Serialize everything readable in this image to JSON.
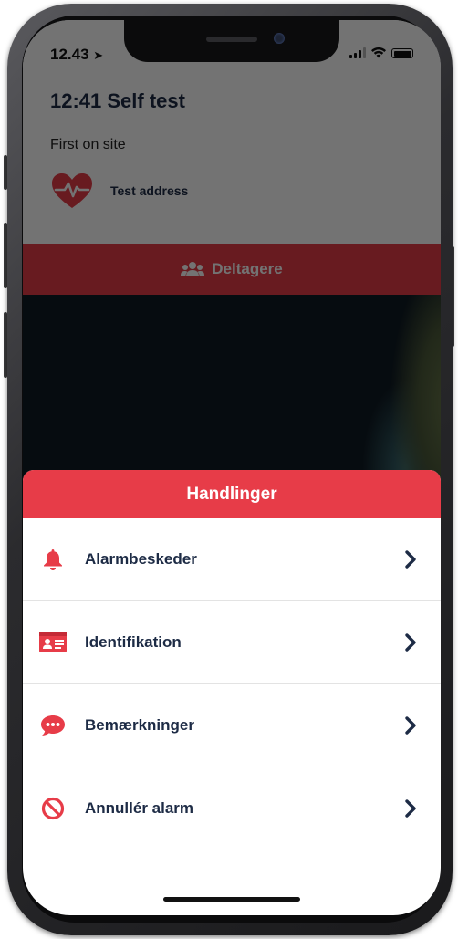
{
  "status_bar": {
    "time": "12.43"
  },
  "header": {
    "title": "12:41 Self test",
    "subtitle": "First on site",
    "address": "Test address"
  },
  "participants_button": {
    "label": "Deltagere",
    "icon": "users-icon"
  },
  "actions_sheet": {
    "title": "Handlinger",
    "items": [
      {
        "label": "Alarmbeskeder",
        "icon": "bell-icon"
      },
      {
        "label": "Identifikation",
        "icon": "id-card-icon"
      },
      {
        "label": "Bemærkninger",
        "icon": "comment-icon"
      },
      {
        "label": "Annullér alarm",
        "icon": "ban-icon"
      }
    ]
  },
  "colors": {
    "accent_red": "#e73c48",
    "text_navy": "#1d2b45",
    "overlay": "rgba(0,0,0,0.55)"
  }
}
